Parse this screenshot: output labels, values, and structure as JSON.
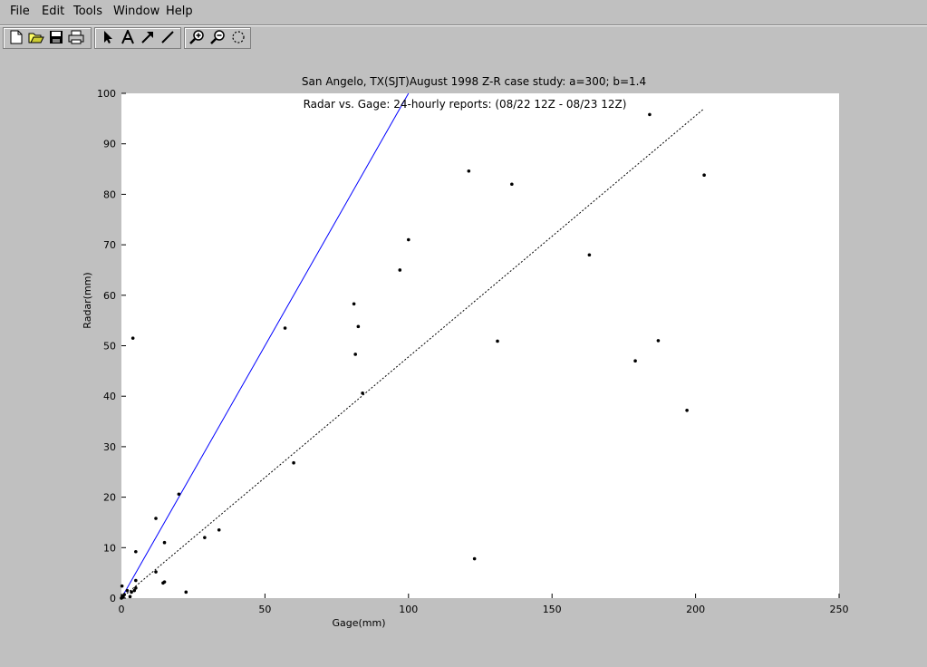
{
  "menu": {
    "file": "File",
    "edit": "Edit",
    "tools": "Tools",
    "window": "Window",
    "help": "Help"
  },
  "toolbar": {
    "icons": [
      "new-file-icon",
      "open-folder-icon",
      "save-icon",
      "print-icon",
      "arrow-select-icon",
      "text-insert-icon",
      "arrow-insert-icon",
      "line-insert-icon",
      "zoom-in-icon",
      "zoom-out-icon",
      "rotate-icon"
    ]
  },
  "colors": {
    "background": "#c0c0c0",
    "axes_face": "#ffffff",
    "fit_line": "#0000ff",
    "reference_line": "#000000",
    "markers": "#000000"
  },
  "chart_data": {
    "type": "scatter",
    "title": "San Angelo, TX(SJT)August 1998 Z-R case study: a=300; b=1.4",
    "subtitle": "Radar vs. Gage: 24-hourly reports: (08/22 12Z - 08/23 12Z)",
    "xlabel": "Gage(mm)",
    "ylabel": "Radar(mm)",
    "xlim": [
      0,
      250
    ],
    "ylim": [
      0,
      100
    ],
    "xticks": [
      0,
      50,
      100,
      150,
      200,
      250
    ],
    "yticks": [
      0,
      10,
      20,
      30,
      40,
      50,
      60,
      70,
      80,
      90,
      100
    ],
    "grid": false,
    "legend": "none",
    "points": [
      [
        0,
        0
      ],
      [
        0.3,
        0.4
      ],
      [
        0.6,
        0.2
      ],
      [
        1,
        0.7
      ],
      [
        0.2,
        2.4
      ],
      [
        2,
        1.5
      ],
      [
        3,
        0.3
      ],
      [
        3.5,
        1.2
      ],
      [
        4.5,
        1.5
      ],
      [
        5,
        2
      ],
      [
        4,
        51.5
      ],
      [
        5,
        9.2
      ],
      [
        5,
        3.5
      ],
      [
        12,
        15.8
      ],
      [
        12,
        5.2
      ],
      [
        14.5,
        3
      ],
      [
        15,
        3.2
      ],
      [
        15,
        11
      ],
      [
        20,
        20.6
      ],
      [
        22.5,
        1.2
      ],
      [
        29,
        12
      ],
      [
        34,
        13.5
      ],
      [
        57,
        53.5
      ],
      [
        60,
        26.8
      ],
      [
        81,
        58.3
      ],
      [
        81.5,
        48.3
      ],
      [
        82.5,
        53.8
      ],
      [
        84,
        40.6
      ],
      [
        97,
        65
      ],
      [
        100,
        71
      ],
      [
        121,
        84.6
      ],
      [
        123,
        7.8
      ],
      [
        131,
        50.9
      ],
      [
        136,
        82
      ],
      [
        163,
        68
      ],
      [
        179,
        47
      ],
      [
        184,
        95.8
      ],
      [
        187,
        51
      ],
      [
        197,
        37.2
      ],
      [
        203,
        83.8
      ]
    ],
    "lines": [
      {
        "style": "solid",
        "color": "#0000ff",
        "x": [
          0,
          100
        ],
        "y": [
          0,
          100
        ]
      },
      {
        "style": "dotted",
        "color": "#000000",
        "x": [
          0,
          203
        ],
        "y": [
          0,
          97
        ]
      }
    ]
  }
}
